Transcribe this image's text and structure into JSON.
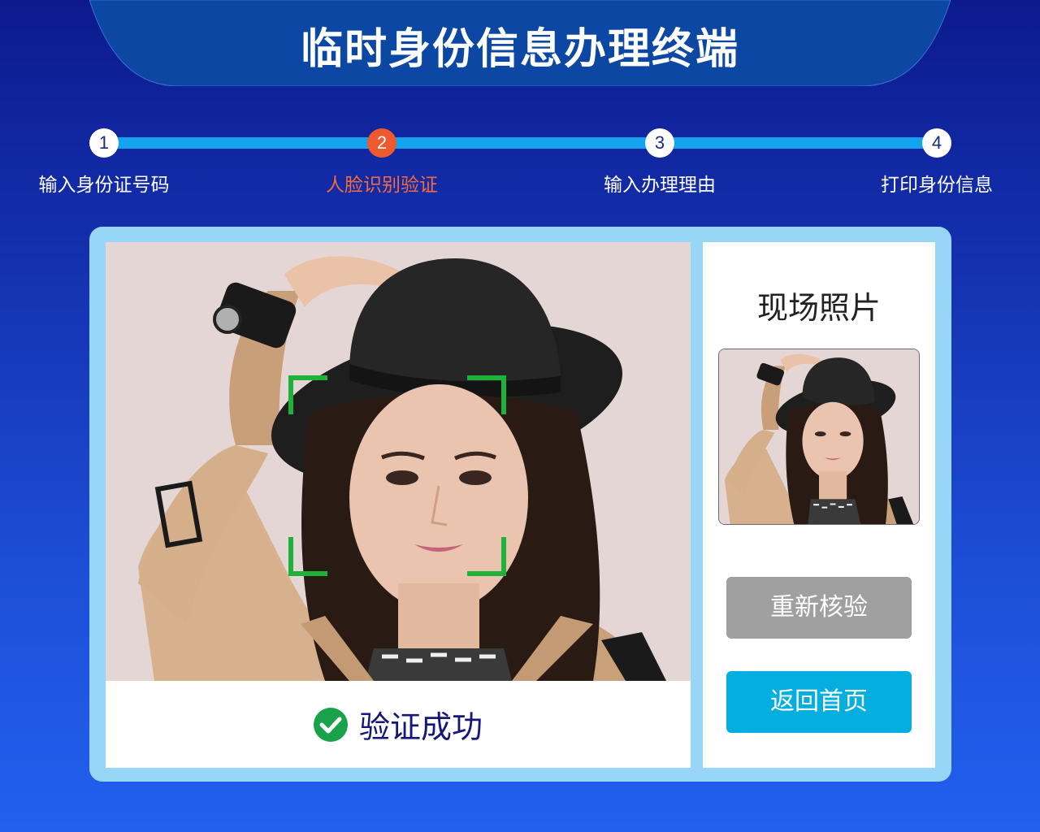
{
  "header": {
    "title": "临时身份信息办理终端"
  },
  "steps": [
    {
      "number": "1",
      "label": "输入身份证号码",
      "active": false
    },
    {
      "number": "2",
      "label": "人脸识别验证",
      "active": true
    },
    {
      "number": "3",
      "label": "输入办理理由",
      "active": false
    },
    {
      "number": "4",
      "label": "打印身份信息",
      "active": false
    }
  ],
  "verification": {
    "status_text": "验证成功",
    "status_color": "#1aa24a"
  },
  "side_panel": {
    "title": "现场照片",
    "recheck_label": "重新核验",
    "home_label": "返回首页"
  },
  "colors": {
    "accent": "#04aede",
    "active_step": "#ee5a2e",
    "face_frame": "#1fb238"
  }
}
